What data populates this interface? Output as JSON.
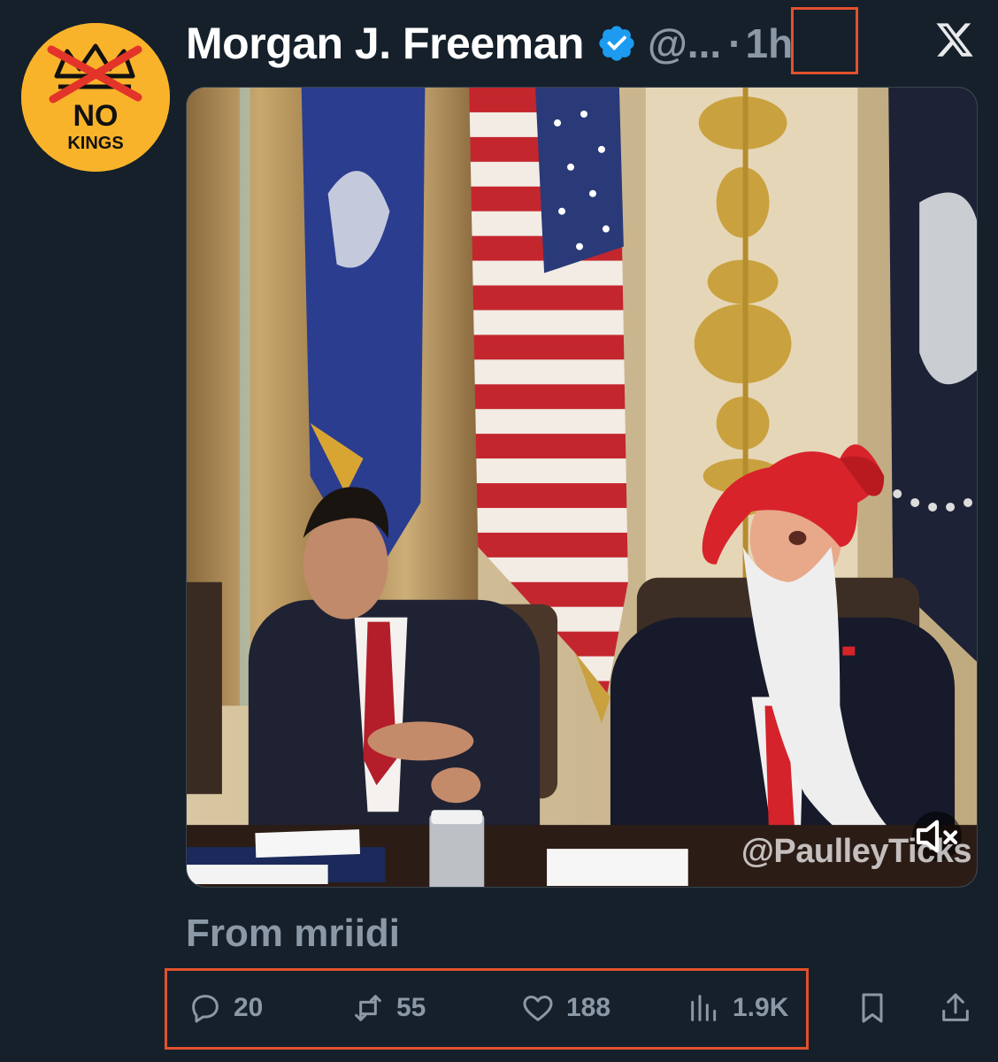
{
  "author": {
    "display_name": "Morgan J. Freeman",
    "handle": "@...",
    "separator": "·",
    "timestamp": "1h",
    "verified": true,
    "avatar_text_line1": "NO",
    "avatar_text_line2": "KINGS"
  },
  "media": {
    "watermark": "@PaulleyTicks",
    "mute_icon": "speaker-muted-icon"
  },
  "source_label": "From mriidi",
  "actions": {
    "replies": "20",
    "reposts": "55",
    "likes": "188",
    "views": "1.9K"
  },
  "colors": {
    "background": "#15202b",
    "secondary_text": "#8b98a5",
    "verified_blue": "#1d9bf0",
    "highlight_box": "#e3512c",
    "avatar_bg": "#f9b32a"
  }
}
